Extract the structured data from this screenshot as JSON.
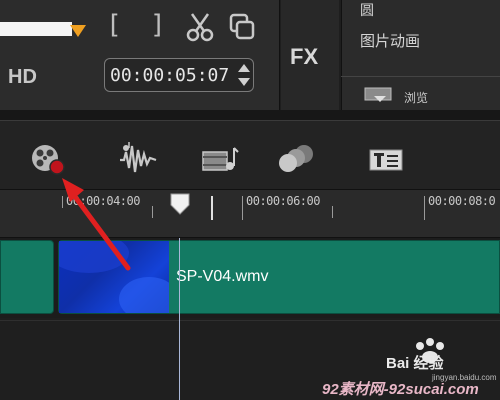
{
  "preview": {
    "bracket_open": "[",
    "bracket_close": "]",
    "hd_label": "HD",
    "timecode": "00:00:05:07"
  },
  "fx": {
    "label": "FX"
  },
  "effects_panel": {
    "items": [
      "圆",
      "图片动画"
    ],
    "browse_label": "浏览"
  },
  "toolbar": {
    "tools": [
      "record-capture-icon",
      "audio-waveform-icon",
      "title-music-icon",
      "overlay-spheres-icon",
      "title-text-icon"
    ]
  },
  "ruler": {
    "labels": [
      "00:00:04:00",
      "00:00:06:00",
      "00:00:08:0"
    ]
  },
  "timeline": {
    "clip_name": "SP-V04.wmv"
  },
  "colors": {
    "clip_green": "#137a63",
    "annotation_red": "#e02020",
    "timecode_border": "#7a7a7a"
  },
  "watermark": {
    "baidu": "Bai 经验",
    "site": "92素材网-92sucai.com",
    "jingyan_url": "jingyan.baidu.com"
  }
}
